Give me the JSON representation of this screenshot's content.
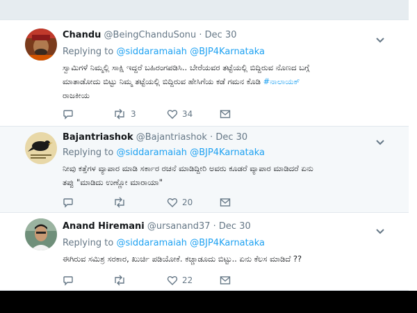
{
  "tweets": [
    {
      "name": "Chandu",
      "handle": "@BeingChanduSonu",
      "sep": "·",
      "date": "Dec 30",
      "replying_prefix": "Replying to",
      "mention1": "@siddaramaiah",
      "mention2": "@BJP4Karnataka",
      "line1": "ಸ್ವಾಮಿಗಳೆ ನಿಮ್ಮಲ್ಲಿ ಸಾಕ್ಷಿ ಇದ್ದರೆ ಬಹಿರಂಗಪಡಿಸಿ.. ಬೇರೆಯವರ ತಟ್ಟೆಯಲ್ಲಿ ಬಿದ್ದಿರುವ ನೊಣದ ಬಗ್ಗೆ",
      "line2": "ಮಾತಾಡೋದು ಬಿಟ್ಟು ನಿಮ್ಮ ತಟ್ಟೆಯಲ್ಲಿ ಬಿದ್ದಿರುವ ಹೇಸಿಗೆಯ ಕಡೆ ಗಮನ ಕೊಡಿ",
      "hashtag": "#ನಾಲಾಯಕ್",
      "line3": "ರಾಜಕೀಯ",
      "retweets": "3",
      "likes": "34"
    },
    {
      "name": "Bajantriashok",
      "handle": "@Bajantriashok",
      "sep": "·",
      "date": "Dec 30",
      "replying_prefix": "Replying to",
      "mention1": "@siddaramaiah",
      "mention2": "@BJP4Karnataka",
      "line1": "ನೀವು ಕತ್ತೆಗಳ ವ್ಯಾಪಾರ ಮಾಡಿ ಸರ್ಕಾರ ರಚನೆ ಮಾಡಿದ್ದೀರಿ ಅವರು ಕೂಡರೆ ವ್ಯಾಪಾರ ಮಾಡಿದರೆ ಏನು",
      "line2": "ತಪ್ಪು \"ಮಾಡಿದು ಉಣ್ಣೋ ಮಾರಾಯಾ\"",
      "retweets": "",
      "likes": "20"
    },
    {
      "name": "Anand Hiremani",
      "handle": "@ursanand37",
      "sep": "·",
      "date": "Dec 30",
      "replying_prefix": "Replying to",
      "mention1": "@siddaramaiah",
      "mention2": "@BJP4Karnataka",
      "line1": "ಈಗಿರುವ ಸಮಿಶ್ರ ಸರಕಾರ, ಖುರ್ಚಿ ಪಡಿಯೋಕೆ. ಕಚ್ಚಾಡೂದು ಬಿಟ್ಟು.. ಏನು ಕೆಲಸ ಮಾಡಿದೆ ??",
      "retweets": "",
      "likes": "22"
    }
  ],
  "colors": {
    "accent": "#1da1f2",
    "text": "#14171a",
    "muted": "#657786"
  }
}
